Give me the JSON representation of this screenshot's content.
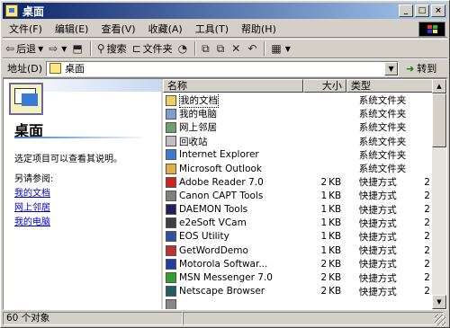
{
  "window": {
    "title": "桌面"
  },
  "menu": [
    "文件(F)",
    "编辑(E)",
    "查看(V)",
    "收藏(A)",
    "工具(T)",
    "帮助(H)"
  ],
  "toolbar": {
    "back": "后退",
    "search": "搜索",
    "folders": "文件夹"
  },
  "address": {
    "label": "地址(D)",
    "value": "桌面",
    "go": "转到"
  },
  "left_pane": {
    "title": "桌面",
    "description": "选定项目可以查看其说明。",
    "see_also": "另请参阅:",
    "links": [
      "我的文档",
      "网上邻居",
      "我的电脑"
    ]
  },
  "columns": {
    "name": "名称",
    "size": "大小",
    "type": "类型"
  },
  "files": [
    {
      "name": "我的文档",
      "size": "",
      "unit": "",
      "type": "系统文件夹",
      "icon": "folder-icon",
      "color": "#f0d060"
    },
    {
      "name": "我的电脑",
      "size": "",
      "unit": "",
      "type": "系统文件夹",
      "icon": "computer-icon",
      "color": "#7aa0d0"
    },
    {
      "name": "网上邻居",
      "size": "",
      "unit": "",
      "type": "系统文件夹",
      "icon": "network-icon",
      "color": "#70a070"
    },
    {
      "name": "回收站",
      "size": "",
      "unit": "",
      "type": "系统文件夹",
      "icon": "recycle-bin-icon",
      "color": "#c0c0c0"
    },
    {
      "name": "Internet Explorer",
      "size": "",
      "unit": "",
      "type": "系统文件夹",
      "icon": "ie-icon",
      "color": "#3b7bd4"
    },
    {
      "name": "Microsoft Outlook",
      "size": "",
      "unit": "",
      "type": "系统文件夹",
      "icon": "outlook-icon",
      "color": "#e0b040"
    },
    {
      "name": "Adobe Reader 7.0",
      "size": "2",
      "unit": "KB",
      "type": "快捷方式",
      "icon": "adobe-reader-icon",
      "color": "#d02020"
    },
    {
      "name": "Canon CAPT Tools",
      "size": "1",
      "unit": "KB",
      "type": "快捷方式",
      "icon": "printer-icon",
      "color": "#808080"
    },
    {
      "name": "DAEMON Tools",
      "size": "1",
      "unit": "KB",
      "type": "快捷方式",
      "icon": "daemon-tools-icon",
      "color": "#202060"
    },
    {
      "name": "e2eSoft VCam",
      "size": "1",
      "unit": "KB",
      "type": "快捷方式",
      "icon": "vcam-icon",
      "color": "#404040"
    },
    {
      "name": "EOS Utility",
      "size": "1",
      "unit": "KB",
      "type": "快捷方式",
      "icon": "camera-icon",
      "color": "#3050a0"
    },
    {
      "name": "GetWordDemo",
      "size": "1",
      "unit": "KB",
      "type": "快捷方式",
      "icon": "app-icon",
      "color": "#c03030"
    },
    {
      "name": "Motorola Softwar...",
      "size": "2",
      "unit": "KB",
      "type": "快捷方式",
      "icon": "motorola-icon",
      "color": "#2040a0"
    },
    {
      "name": "MSN Messenger 7.0",
      "size": "2",
      "unit": "KB",
      "type": "快捷方式",
      "icon": "msn-icon",
      "color": "#30a030"
    },
    {
      "name": "Netscape Browser",
      "size": "2",
      "unit": "KB",
      "type": "快捷方式",
      "icon": "netscape-icon",
      "color": "#206060"
    },
    {
      "name": "",
      "size": "",
      "unit": "",
      "type": "",
      "icon": "app-icon",
      "color": "#888888"
    }
  ],
  "extra_col": [
    "",
    "",
    "",
    "",
    "",
    "",
    "2",
    "2",
    "2",
    "2",
    "2",
    "2",
    "2",
    "2",
    "2",
    ""
  ],
  "status": {
    "count": "60 个对象"
  }
}
